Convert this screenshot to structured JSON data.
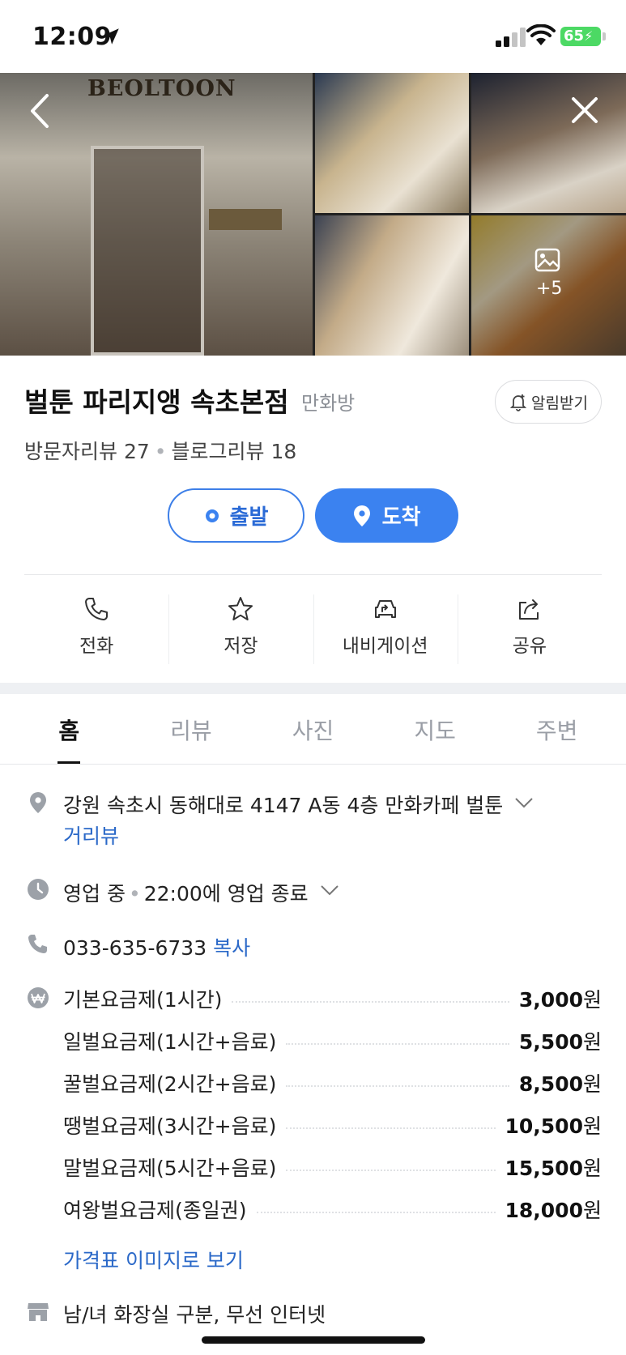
{
  "status_bar": {
    "time": "12:09",
    "battery": "65"
  },
  "gallery": {
    "sign_text": "BEOLTOON",
    "more_count": "+5"
  },
  "place": {
    "title": "벌툰 파리지앵 속초본점",
    "category": "만화방",
    "alarm_label": "알림받기",
    "visitor_reviews": "방문자리뷰 27",
    "blog_reviews": "블로그리뷰 18"
  },
  "route": {
    "depart_label": "출발",
    "arrive_label": "도착"
  },
  "actions": [
    {
      "label": "전화",
      "icon": "phone-icon"
    },
    {
      "label": "저장",
      "icon": "star-icon"
    },
    {
      "label": "내비게이션",
      "icon": "navigation-car-icon"
    },
    {
      "label": "공유",
      "icon": "share-icon"
    }
  ],
  "tabs": [
    {
      "label": "홈",
      "active": true
    },
    {
      "label": "리뷰"
    },
    {
      "label": "사진"
    },
    {
      "label": "지도"
    },
    {
      "label": "주변"
    }
  ],
  "info": {
    "address": "강원 속초시 동해대로 4147 A동 4층 만화카페 벌툰",
    "streetview": "거리뷰",
    "hours_status": "영업 중",
    "hours_detail": "22:00에 영업 종료",
    "phone": "033-635-6733",
    "copy_label": "복사",
    "price_link": "가격표 이미지로 보기",
    "facilities": "남/녀 화장실 구분, 무선 인터넷"
  },
  "prices": [
    {
      "name": "기본요금제(1시간)",
      "amount": "3,000",
      "unit": "원"
    },
    {
      "name": "일벌요금제(1시간+음료)",
      "amount": "5,500",
      "unit": "원"
    },
    {
      "name": "꿀벌요금제(2시간+음료)",
      "amount": "8,500",
      "unit": "원"
    },
    {
      "name": "땡벌요금제(3시간+음료)",
      "amount": "10,500",
      "unit": "원"
    },
    {
      "name": "말벌요금제(5시간+음료)",
      "amount": "15,500",
      "unit": "원"
    },
    {
      "name": "여왕벌요금제(종일권)",
      "amount": "18,000",
      "unit": "원"
    }
  ],
  "colors": {
    "accent_blue": "#3b82f0",
    "link_blue": "#2a68c8",
    "battery_green": "#4cd964"
  }
}
